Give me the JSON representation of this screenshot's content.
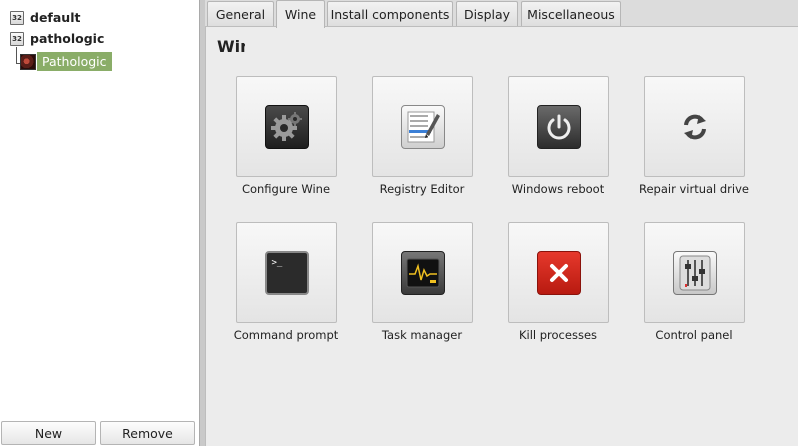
{
  "tree": {
    "prefixes": [
      {
        "badge": "32",
        "label": "default"
      },
      {
        "badge": "32",
        "label": "pathologic"
      }
    ],
    "selected_app": "Pathologic"
  },
  "buttons": {
    "new": "New",
    "remove": "Remove"
  },
  "tabs": [
    "General",
    "Wine",
    "Install components",
    "Display",
    "Miscellaneous"
  ],
  "active_tab": "Wine",
  "section_title": "Wine",
  "tools": [
    {
      "label": "Configure Wine",
      "icon": "gear-icon"
    },
    {
      "label": "Registry Editor",
      "icon": "registry-editor-icon"
    },
    {
      "label": "Windows reboot",
      "icon": "power-icon"
    },
    {
      "label": "Repair virtual drive",
      "icon": "refresh-icon"
    },
    {
      "label": "Command prompt",
      "icon": "terminal-icon"
    },
    {
      "label": "Task manager",
      "icon": "task-manager-icon"
    },
    {
      "label": "Kill processes",
      "icon": "kill-icon"
    },
    {
      "label": "Control panel",
      "icon": "control-panel-icon"
    }
  ],
  "colors": {
    "selection": "#8aad68",
    "kill": "#d6271c"
  }
}
